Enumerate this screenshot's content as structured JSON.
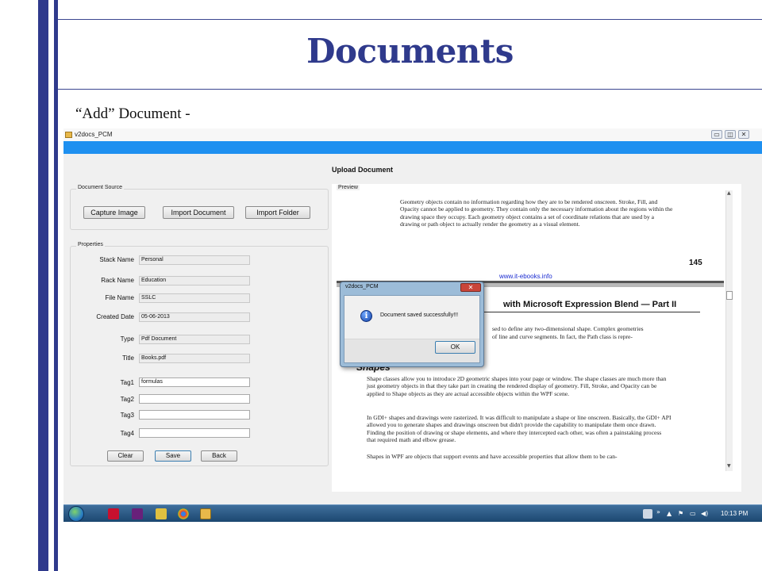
{
  "slide": {
    "title": "Documents",
    "caption": "“Add” Document -"
  },
  "window": {
    "title": "v2docs_PCM",
    "controls": {
      "minimize": "▭",
      "maximize": "◫",
      "close": "✕"
    },
    "heading": "Upload Document"
  },
  "document_source": {
    "label": "Document Source",
    "buttons": [
      "Capture Image",
      "Import Document",
      "Import Folder"
    ]
  },
  "properties": {
    "label": "Properties",
    "fields": [
      {
        "label": "Stack Name",
        "value": "Personal"
      },
      {
        "label": "Rack Name",
        "value": "Education"
      },
      {
        "label": "File Name",
        "value": "SSLC"
      },
      {
        "label": "Created Date",
        "value": "05-06-2013"
      },
      {
        "label": "Type",
        "value": "Pdf Document"
      },
      {
        "label": "Title",
        "value": "Books.pdf"
      }
    ],
    "tags": [
      {
        "label": "Tag1",
        "value": "formulas"
      },
      {
        "label": "Tag2",
        "value": ""
      },
      {
        "label": "Tag3",
        "value": ""
      },
      {
        "label": "Tag4",
        "value": ""
      }
    ],
    "buttons": {
      "clear": "Clear",
      "save": "Save",
      "back": "Back"
    }
  },
  "preview": {
    "label": "Preview",
    "page1": {
      "para": "Geometry objects contain no information regarding how they are to be rendered onscreen. Stroke, Fill, and Opacity cannot be applied to geometry. They contain only the necessary information about the regions within the drawing space they occupy. Each geometry object contains a set of coordinate relations that are used by a drawing or path object to actually render the geometry as a visual element.",
      "page_number": "145",
      "footer_url": "www.it-ebooks.info"
    },
    "page2": {
      "heading_fragment": "with Microsoft Expression Blend — Part II",
      "intro_line1": "sed to define any two-dimensional shape. Complex geometries",
      "intro_line2": "of line and curve segments. In fact, the Path class is repre-",
      "section_title": "Shapes",
      "para1": "Shape classes allow you to introduce 2D geometric shapes into your page or window. The shape classes are much more than just geometry objects in that they take part in creating the rendered display of geometry. Fill, Stroke, and Opacity can be applied to Shape objects as they are actual accessible objects within the WPF scene.",
      "para2": "In GDI+ shapes and drawings were rasterized. It was difficult to manipulate a shape or line onscreen. Basically, the GDI+ API allowed you to generate shapes and drawings onscreen but didn't provide the capability to manipulate them once drawn. Finding the position of drawing or shape elements, and where they intercepted each other, was often a painstaking process that required math and elbow grease.",
      "para3": "Shapes in WPF are objects that support events and have accessible properties that allow them to be can-"
    }
  },
  "dialog": {
    "title": "v2docs_PCM",
    "message": "Document saved successfully!!!",
    "ok_label": "OK",
    "close_glyph": "✕",
    "icon_glyph": "i"
  },
  "taskbar": {
    "icons": [
      "start-orb",
      "pdf-icon",
      "visual-studio-icon",
      "tools-icon",
      "chrome-icon",
      "v2docs-icon"
    ],
    "tray_chevron": "»",
    "tray_up": "▲",
    "clock": "10:13 PM"
  }
}
